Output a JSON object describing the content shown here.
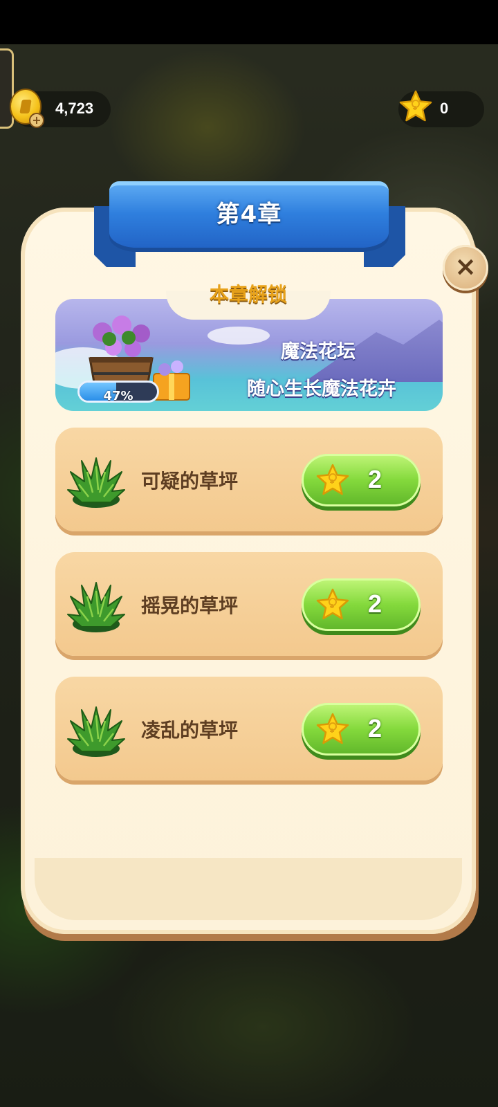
{
  "hud": {
    "coins": "4,723",
    "stars": "0"
  },
  "chapter": {
    "title": "第4章",
    "unlock_title": "本章解锁",
    "reward": {
      "name": "魔法花坛",
      "description": "随心生长魔法花卉",
      "progress": 0.47,
      "progress_label": "47%"
    },
    "tasks": [
      {
        "label": "可疑的草坪",
        "cost": "2",
        "icon": "grass-bush-icon"
      },
      {
        "label": "摇晃的草坪",
        "cost": "2",
        "icon": "grass-bush-icon"
      },
      {
        "label": "凌乱的草坪",
        "cost": "2",
        "icon": "grass-bush-icon"
      }
    ]
  },
  "colors": {
    "ribbon": "#2f7fde",
    "panel": "#fff7e4",
    "task_row": "#f3c98e",
    "button_green": "#84d93c",
    "star_gold": "#ffd21a"
  }
}
